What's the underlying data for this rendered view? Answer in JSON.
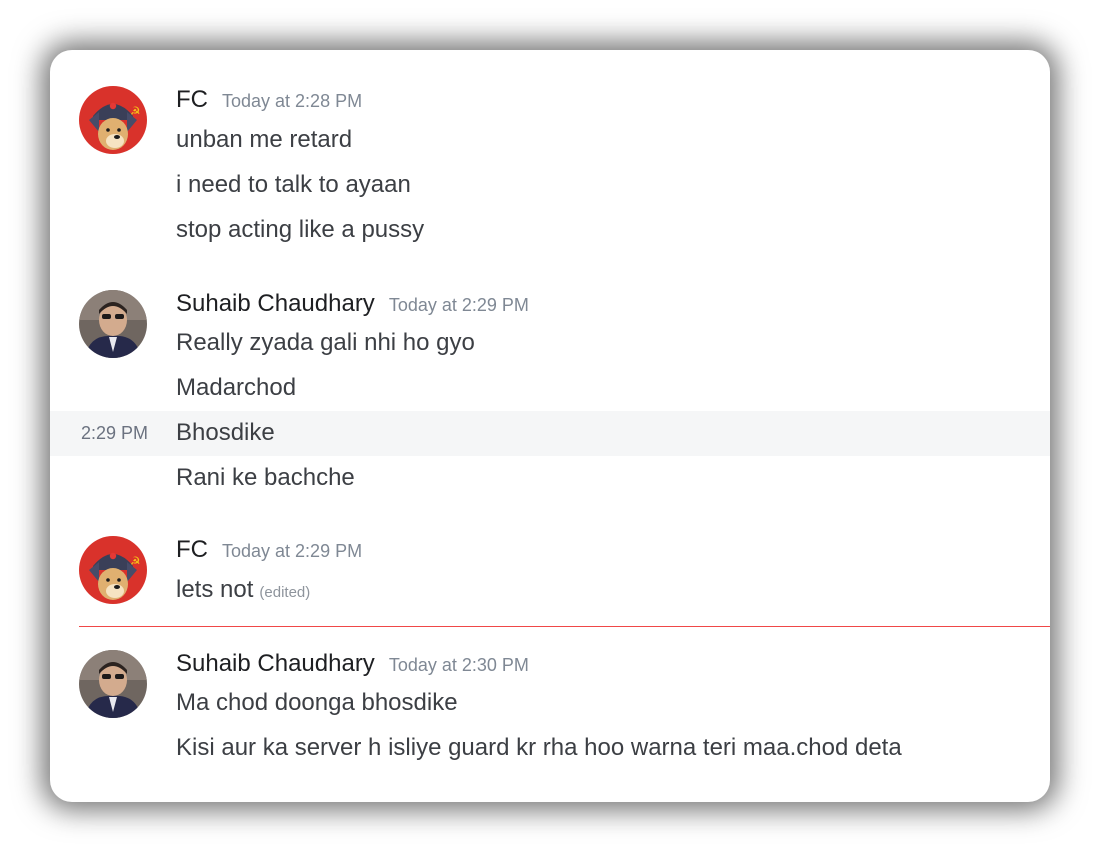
{
  "messages": [
    {
      "author": "FC",
      "timestamp": "Today at 2:28 PM",
      "lines": [
        "unban me retard",
        "i need to talk to ayaan",
        "stop acting like a pussy"
      ]
    },
    {
      "author": "Suhaib Chaudhary",
      "timestamp": "Today at 2:29 PM",
      "lines": [
        "Really zyada gali nhi ho gyo",
        "Madarchod",
        "Bhosdike",
        "Rani ke bachche"
      ],
      "hover_time": "2:29 PM"
    },
    {
      "author": "FC",
      "timestamp": "Today at 2:29 PM",
      "lines": [
        "lets not"
      ],
      "edited_label": "(edited)"
    },
    {
      "author": "Suhaib Chaudhary",
      "timestamp": "Today at 2:30 PM",
      "lines": [
        "Ma chod doonga bhosdike",
        "Kisi aur ka server h isliye guard kr rha hoo warna teri maa.chod deta"
      ]
    }
  ],
  "colors": {
    "new_messages_divider": "#f04747",
    "hover_background": "#f5f6f7"
  },
  "icons": {
    "fc_avatar": "shiba-dog-ushanka-soviet-avatar",
    "suhaib_avatar": "user-photo-avatar"
  }
}
